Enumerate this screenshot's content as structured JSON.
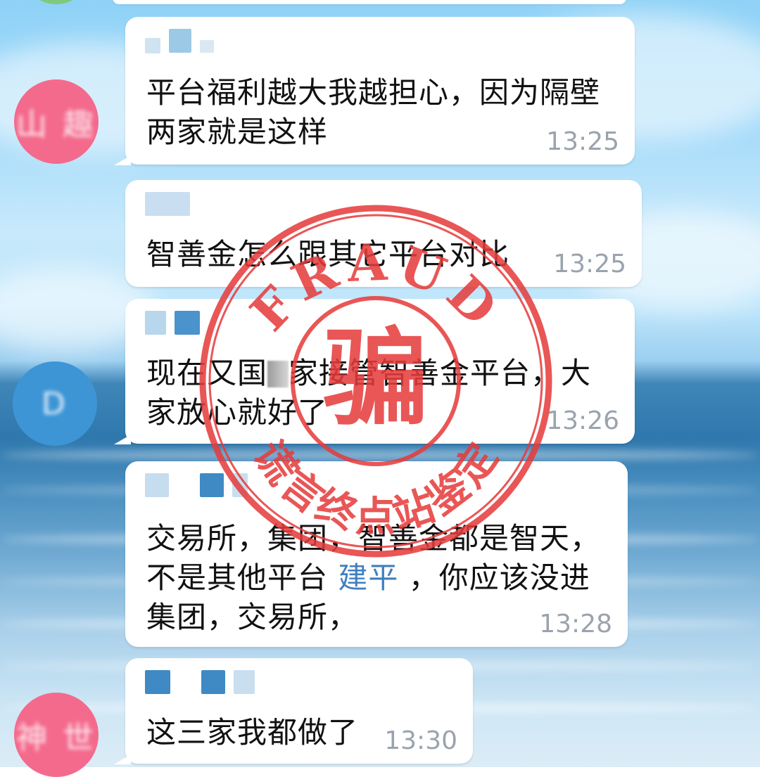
{
  "messages": [
    {
      "text": "平台福利越大我越担心，因为隔壁两家就是这样",
      "time": "13:25",
      "avatar_color": "#f46a8d",
      "avatar_label": "山 趣"
    },
    {
      "text": "智善金怎么跟其它平台对比",
      "time": "13:25"
    },
    {
      "text_before": "现在又国",
      "text_after": "家接管智善金平台，大家放心就好了",
      "time": "13:26",
      "avatar_color": "#3d95d6",
      "avatar_label": "D"
    },
    {
      "text_before": "交易所，集团，智善金都是智天，不是其他平台 ",
      "mention": "建平",
      "text_after": " ，你应该没进集团，交易所，",
      "time": "13:28"
    },
    {
      "text": "这三家我都做了",
      "time": "13:30",
      "avatar_color": "#f46a8d",
      "avatar_label": "神 世"
    }
  ],
  "stamp": {
    "top_text": "FRAUD",
    "center_char": "骗",
    "bottom_text": "谎言终点站鉴定",
    "color": "#e63b3b"
  },
  "colors": {
    "bubble": "#ffffff",
    "message_text": "#111111",
    "timestamp": "#9aa3ad",
    "mention": "#3f7fbf"
  }
}
